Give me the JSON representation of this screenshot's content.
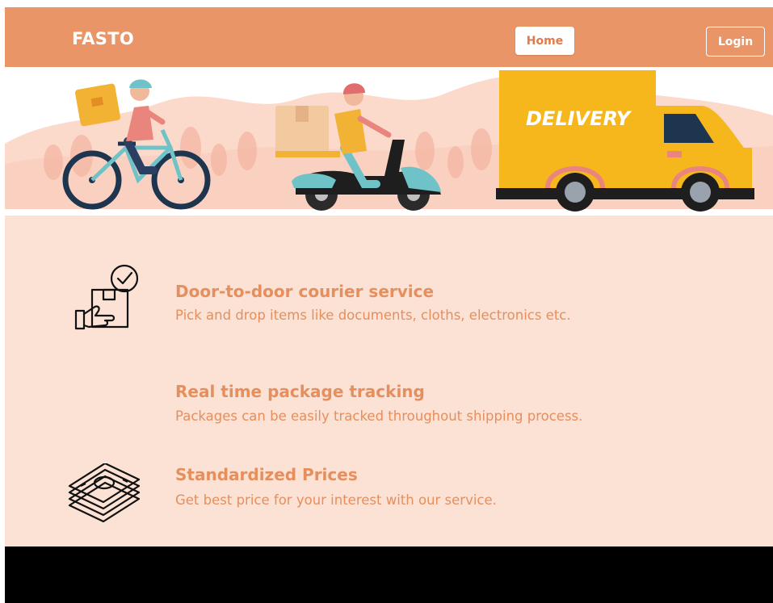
{
  "colors": {
    "navbar": "#e99567",
    "accent_text": "#e58f5e",
    "page_bg": "#fbe2d4",
    "footer": "#000000"
  },
  "navbar": {
    "brand": "FASTO",
    "home_label": "Home",
    "login_label": "Login"
  },
  "hero": {
    "truck_text": "DELIVERY"
  },
  "features": [
    {
      "title": "Door-to-door courier service",
      "description": "Pick and drop items like documents, cloths, electronics etc.",
      "icon": "courier-box-icon"
    },
    {
      "title": "Real time package tracking",
      "description": "Packages can be easily tracked throughout shipping process.",
      "icon": ""
    },
    {
      "title": "Standardized Prices",
      "description": "Get best price for your interest with our service.",
      "icon": "money-stack-icon"
    }
  ]
}
